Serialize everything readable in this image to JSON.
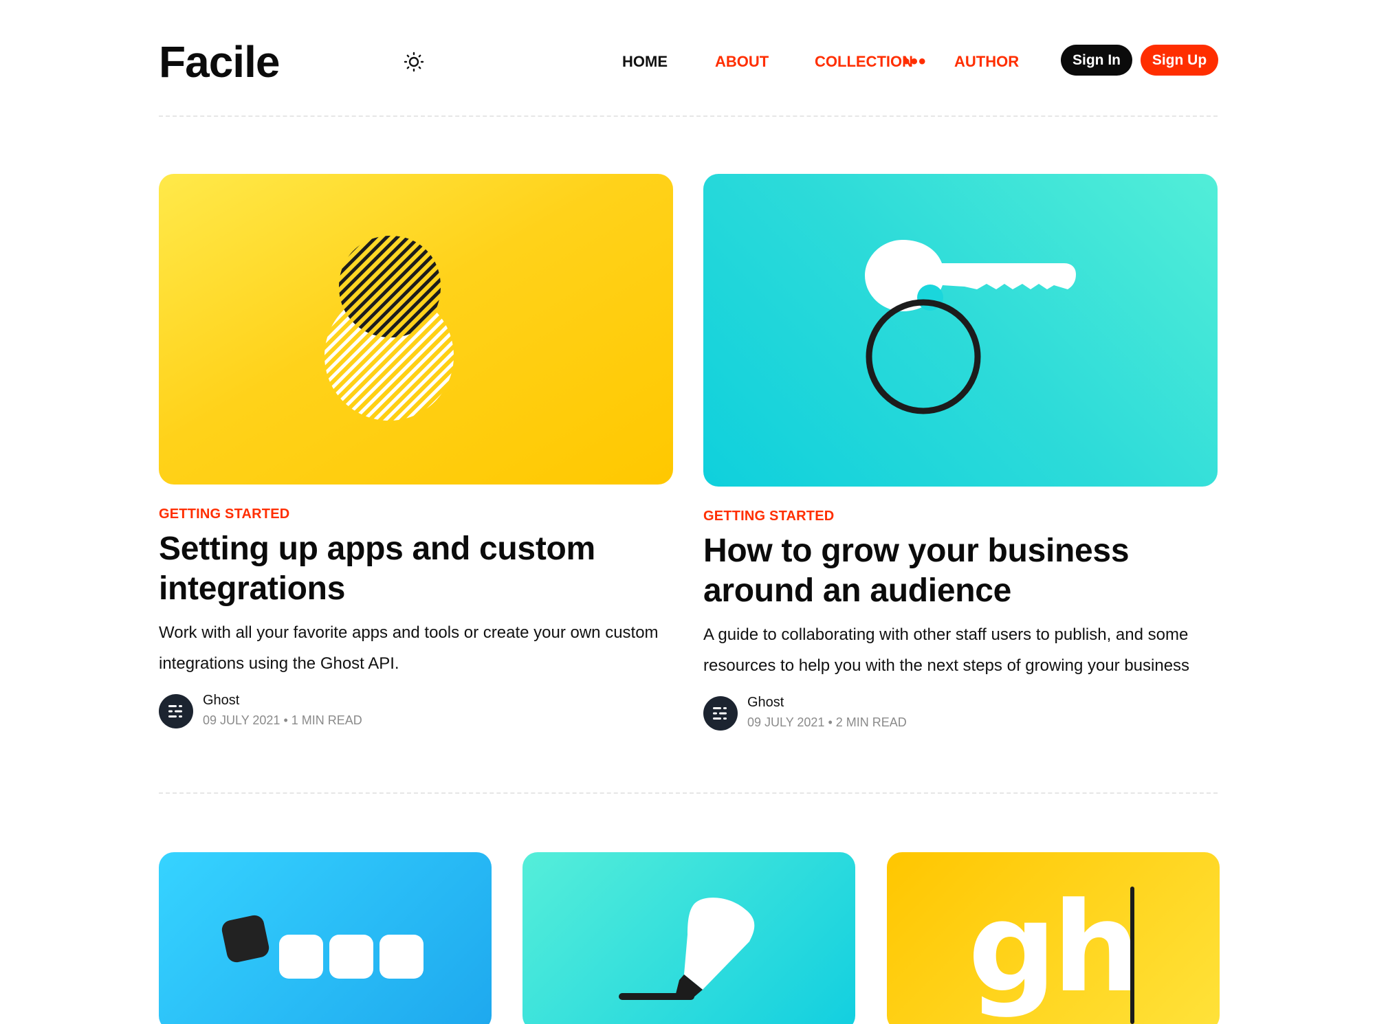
{
  "header": {
    "logo": "Facile",
    "nav": [
      {
        "label": "HOME"
      },
      {
        "label": "ABOUT"
      },
      {
        "label": "COLLECTION"
      },
      {
        "label": "AUTHOR"
      }
    ],
    "more_label": "•••",
    "sign_in_label": "Sign In",
    "sign_up_label": "Sign Up"
  },
  "featured": [
    {
      "tag": "GETTING STARTED",
      "title": "Setting up apps and custom integrations",
      "excerpt": "Work with all your favorite apps and tools or create your own custom integrations using the Ghost API.",
      "author": "Ghost",
      "date": "09 JULY 2021",
      "read_time": "1 MIN READ",
      "meta_separator": "•",
      "image_icon": "venn-circles-icon"
    },
    {
      "tag": "GETTING STARTED",
      "title": "How to grow your business around an audience",
      "excerpt": "A guide to collaborating with other staff users to publish, and some resources to help you with the next steps of growing your business",
      "author": "Ghost",
      "date": "09 JULY 2021",
      "read_time": "2 MIN READ",
      "meta_separator": "•",
      "image_icon": "key-ring-icon"
    }
  ],
  "cards": [
    {
      "image_icon": "rounded-squares-icon"
    },
    {
      "image_icon": "pen-marker-icon"
    },
    {
      "image_icon": "gh-typing-icon",
      "image_text": "gh"
    }
  ],
  "colors": {
    "accent": "#ff2e00",
    "dark": "#0b0b0b",
    "yellow": "#ffd000",
    "teal": "#1ad6dc",
    "blue": "#2bb8f5"
  }
}
